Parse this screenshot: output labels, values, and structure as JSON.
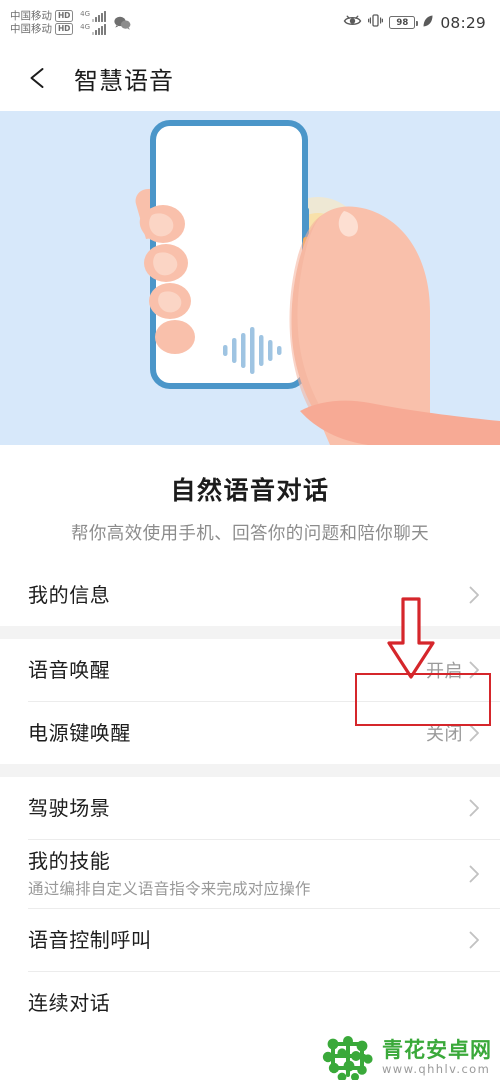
{
  "statusbar": {
    "carrier_lines": [
      {
        "name": "中国移动",
        "badge": "HD"
      },
      {
        "name": "中国移动",
        "badge": "HD"
      }
    ],
    "signal_labels": [
      "4G",
      "4G"
    ],
    "icons": [
      "eye-care-icon",
      "vibrate-icon",
      "wechat-icon",
      "leaf-power-saving-icon"
    ],
    "battery_percent": "98",
    "time": "08:29"
  },
  "header": {
    "back_icon": "back-arrow-icon",
    "title": "智慧语音"
  },
  "hero": {
    "illustration": "hand-holding-phone-voice-illustration",
    "bg_color": "#d7e8fa",
    "phone_border_color": "#4b96c9",
    "skin_color": "#fbc6b2",
    "glow_color": "#fbe0a8",
    "waveform_color": "#9fc4e2"
  },
  "intro": {
    "title": "自然语音对话",
    "subtitle": "帮你高效使用手机、回答你的问题和陪你聊天"
  },
  "list": {
    "groups": [
      {
        "rows": [
          {
            "label": "我的信息",
            "desc": "",
            "value": "",
            "chevron": true
          }
        ]
      },
      {
        "rows": [
          {
            "label": "语音唤醒",
            "desc": "",
            "value": "开启",
            "chevron": true
          },
          {
            "label": "电源键唤醒",
            "desc": "",
            "value": "关闭",
            "chevron": true
          }
        ]
      },
      {
        "rows": [
          {
            "label": "驾驶场景",
            "desc": "",
            "value": "",
            "chevron": true
          },
          {
            "label": "我的技能",
            "desc": "通过编排自定义语音指令来完成对应操作",
            "value": "",
            "chevron": true
          },
          {
            "label": "语音控制呼叫",
            "desc": "",
            "value": "",
            "chevron": true
          },
          {
            "label": "连续对话",
            "desc": "",
            "value": "",
            "chevron": true
          }
        ]
      }
    ]
  },
  "annotations": {
    "arrow": {
      "name": "red-down-arrow-annotation",
      "color": "#d5262b"
    },
    "box": {
      "name": "red-highlight-box-annotation",
      "color": "#d5262b"
    }
  },
  "watermark": {
    "logo_icon": "qinghua-android-logo-icon",
    "site_name": "青花安卓网",
    "url": "www.qhhlv.com",
    "color": "#3aa93a"
  }
}
